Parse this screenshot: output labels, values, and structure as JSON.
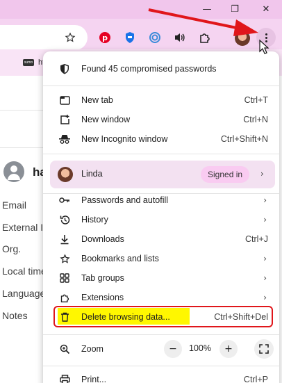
{
  "window": {
    "minimize_glyph": "—",
    "restore_glyph": "❐",
    "close_glyph": "✕"
  },
  "toolbar": {
    "icons": [
      "star-icon",
      "pinterest-icon",
      "extension-shield-icon",
      "extension-target-icon",
      "speaker-icon",
      "puzzle-extensions-icon",
      "profile-avatar",
      "kebab-menu-icon"
    ]
  },
  "bookmarks": {
    "item_logo": "sumo",
    "item_label": "ht"
  },
  "page": {
    "name": "ha",
    "fields": [
      "Email",
      "External I",
      "Org.",
      "Local time",
      "Language",
      "Notes"
    ]
  },
  "menu": {
    "passwords_alert": "Found 45 compromised passwords",
    "new_tab": {
      "label": "New tab",
      "shortcut": "Ctrl+T"
    },
    "new_window": {
      "label": "New window",
      "shortcut": "Ctrl+N"
    },
    "new_incognito": {
      "label": "New Incognito window",
      "shortcut": "Ctrl+Shift+N"
    },
    "profile": {
      "name": "Linda",
      "status": "Signed in"
    },
    "passwords_autofill": {
      "label": "Passwords and autofill"
    },
    "history": {
      "label": "History"
    },
    "downloads": {
      "label": "Downloads",
      "shortcut": "Ctrl+J"
    },
    "bookmarks_lists": {
      "label": "Bookmarks and lists"
    },
    "tab_groups": {
      "label": "Tab groups"
    },
    "extensions": {
      "label": "Extensions"
    },
    "delete_data": {
      "label": "Delete browsing data...",
      "shortcut": "Ctrl+Shift+Del"
    },
    "zoom": {
      "label": "Zoom",
      "value": "100%",
      "minus": "−",
      "plus": "+"
    },
    "print": {
      "label": "Print...",
      "shortcut": "Ctrl+P"
    }
  },
  "colors": {
    "titlebar": "#f1c6ec",
    "highlight": "#fff700",
    "annotation_red": "#e0161b"
  }
}
